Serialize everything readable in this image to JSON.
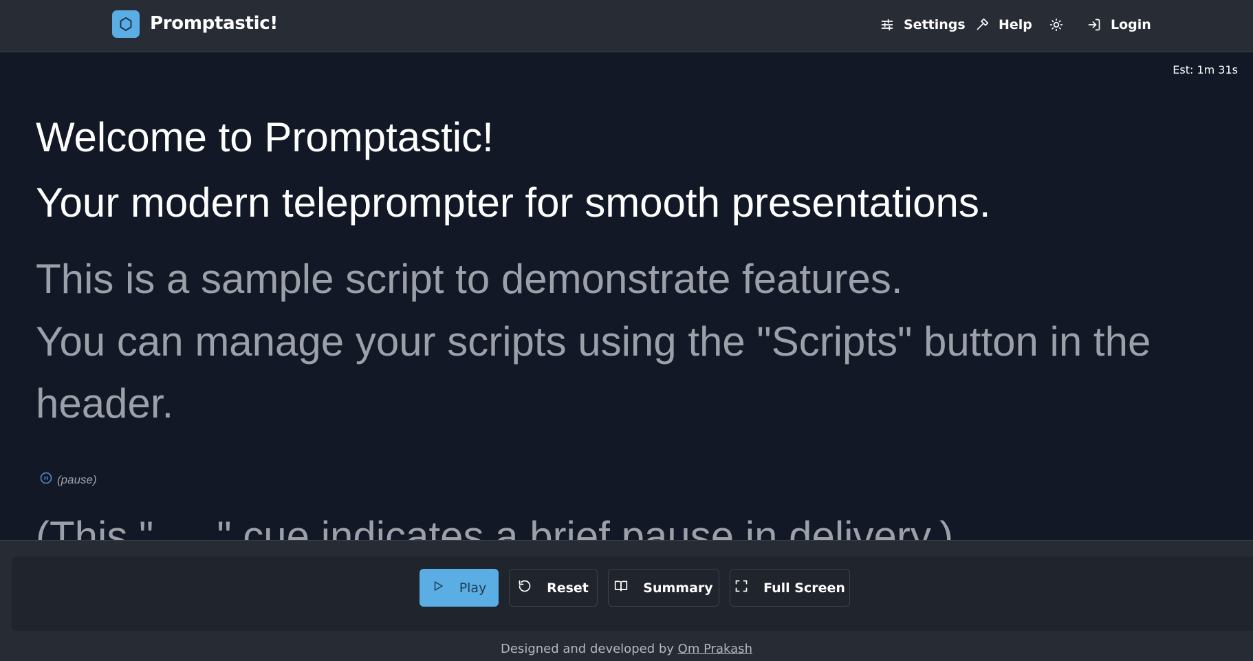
{
  "header": {
    "brand": "Promptastic!",
    "nav": {
      "settings": "Settings",
      "help": "Help",
      "login": "Login"
    }
  },
  "estimate": "Est: 1m 31s",
  "script": {
    "lines": [
      "Welcome to Promptastic!",
      "Your modern teleprompter for smooth presentations.",
      "This is a sample script to demonstrate features.",
      "You can manage your scripts using the \"Scripts\" button in the",
      "header."
    ],
    "pause_label": "(pause)",
    "partial_line": "(This \"",
    "partial_line_end": "\" cue indicates a brief pause in delivery.)"
  },
  "controls": {
    "play": "Play",
    "reset": "Reset",
    "summary": "Summary",
    "fullscreen": "Full Screen"
  },
  "footer": {
    "prefix": "Designed and developed by ",
    "author": "Om Prakash"
  },
  "colors": {
    "accent": "#5aaee3",
    "background": "#121826",
    "header": "#282c35",
    "dim_text": "#9ca0a8"
  }
}
